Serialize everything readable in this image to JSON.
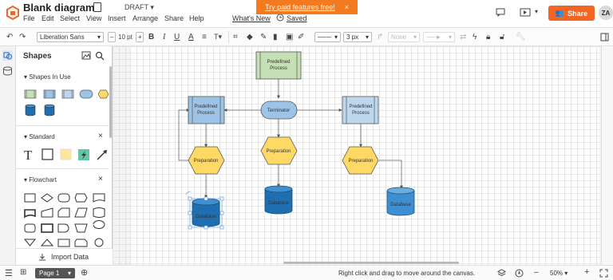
{
  "app": {
    "title": "Blank diagram",
    "status": "DRAFT",
    "menu": [
      "File",
      "Edit",
      "Select",
      "View",
      "Insert",
      "Arrange",
      "Share",
      "Help"
    ],
    "whats_new": "What's New",
    "saved": "Saved",
    "promo": "Try paid features free!",
    "promo_close": "×",
    "share_label": "Share",
    "avatar_initials": "ZA",
    "brand_color": "#f26522"
  },
  "toolbar": {
    "font": "Liberation Sans",
    "font_size": "10 pt",
    "minus": "–",
    "plus": "+",
    "bold": "B",
    "italic": "I",
    "underline": "U",
    "font_color": "A",
    "line_width": "3 px",
    "line_style_end": "None"
  },
  "shapes_panel": {
    "title": "Shapes",
    "sections": [
      {
        "label": "Shapes In Use"
      },
      {
        "label": "Standard"
      },
      {
        "label": "Flowchart"
      }
    ],
    "close": "×",
    "import_label": "Import Data"
  },
  "diagram": {
    "nodes": [
      {
        "id": "top-process",
        "type": "predefined-process",
        "label": "Predefined Process",
        "color": "#c5e0b4"
      },
      {
        "id": "left-process",
        "type": "predefined-process",
        "label": "Predefined Process",
        "color": "#9dc3e6"
      },
      {
        "id": "terminator",
        "type": "terminator",
        "label": "Terminator",
        "color": "#9dc3e6"
      },
      {
        "id": "right-process",
        "type": "predefined-process",
        "label": "Predefined Process",
        "color": "#bdd7ee"
      },
      {
        "id": "prep-left",
        "type": "preparation",
        "label": "Preparation",
        "color": "#ffd966"
      },
      {
        "id": "prep-center",
        "type": "preparation",
        "label": "Preparation",
        "color": "#ffd966"
      },
      {
        "id": "prep-right",
        "type": "preparation",
        "label": "Preparation",
        "color": "#ffd966"
      },
      {
        "id": "db-left",
        "type": "database",
        "label": "Database",
        "color": "#1f6fb0"
      },
      {
        "id": "db-center",
        "type": "database",
        "label": "Database",
        "color": "#1f6fb0"
      },
      {
        "id": "db-right",
        "type": "database",
        "label": "Database",
        "color": "#3d8fd1"
      }
    ]
  },
  "statusbar": {
    "page_label": "Page 1",
    "hint": "Right click and drag to move around the canvas.",
    "zoom": "50%",
    "zoom_minus": "–",
    "zoom_plus": "+"
  }
}
